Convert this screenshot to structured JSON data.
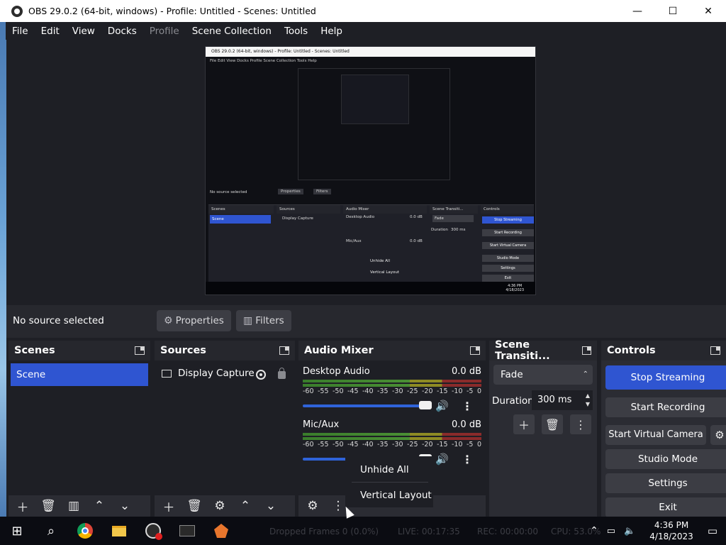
{
  "window": {
    "title": "OBS 29.0.2 (64-bit, windows) - Profile: Untitled - Scenes: Untitled",
    "minimize_glyph": "—",
    "maximize_glyph": "☐",
    "close_glyph": "✕"
  },
  "menu": {
    "file": "File",
    "edit": "Edit",
    "view": "View",
    "docks": "Docks",
    "profile": "Profile",
    "scene_collection": "Scene Collection",
    "tools": "Tools",
    "help": "Help"
  },
  "preview_mirror": {
    "title": "OBS 29.0.2 (64-bit, windows) - Profile: Untitled - Scenes: Untitled",
    "menu": "File  Edit  View  Docks  Profile  Scene Collection  Tools  Help",
    "no_source": "No source selected",
    "properties": "Properties",
    "filters": "Filters",
    "scenes": "Scenes",
    "sources": "Sources",
    "audio_mixer": "Audio Mixer",
    "scene_transitions": "Scene Transiti...",
    "controls": "Controls",
    "scene": "Scene",
    "display_capture": "Display Capture",
    "desktop_audio": "Desktop Audio",
    "mic_aux": "Mic/Aux",
    "db": "0.0 dB",
    "fade": "Fade",
    "duration": "Duration",
    "duration_value": "300 ms",
    "stop_streaming": "Stop Streaming",
    "start_recording": "Start Recording",
    "start_virtual_camera": "Start Virtual Camera",
    "studio_mode": "Studio Mode",
    "settings": "Settings",
    "exit": "Exit",
    "unhide_all": "Unhide All",
    "vertical_layout": "Vertical Layout",
    "clock_time": "4:36 PM",
    "clock_date": "4/18/2023"
  },
  "source_toolbar": {
    "no_source": "No source selected",
    "properties": "Properties",
    "filters": "Filters"
  },
  "scenes": {
    "header": "Scenes",
    "items": [
      "Scene"
    ]
  },
  "sources": {
    "header": "Sources",
    "items": [
      "Display Capture"
    ]
  },
  "audio_mixer": {
    "header": "Audio Mixer",
    "channels": [
      {
        "name": "Desktop Audio",
        "db": "0.0 dB"
      },
      {
        "name": "Mic/Aux",
        "db": "0.0 dB"
      }
    ],
    "scale": [
      "-60",
      "-55",
      "-50",
      "-45",
      "-40",
      "-35",
      "-30",
      "-25",
      "-20",
      "-15",
      "-10",
      "-5",
      "0"
    ]
  },
  "context_menu": {
    "unhide_all": "Unhide All",
    "vertical_layout": "Vertical Layout"
  },
  "transitions": {
    "header": "Scene Transiti...",
    "selected": "Fade",
    "duration_label": "Duration",
    "duration_value": "300 ms"
  },
  "controls": {
    "header": "Controls",
    "stop_streaming": "Stop Streaming",
    "start_recording": "Start Recording",
    "start_virtual_camera": "Start Virtual Camera",
    "studio_mode": "Studio Mode",
    "settings": "Settings",
    "exit": "Exit"
  },
  "status_bar": {
    "dropped_frames": "Dropped Frames 0 (0.0%)",
    "live": "LIVE: 00:17:35",
    "rec": "REC: 00:00:00",
    "cpu": "CPU: 53.0%"
  },
  "taskbar": {
    "time": "4:36 PM",
    "date": "4/18/2023"
  }
}
